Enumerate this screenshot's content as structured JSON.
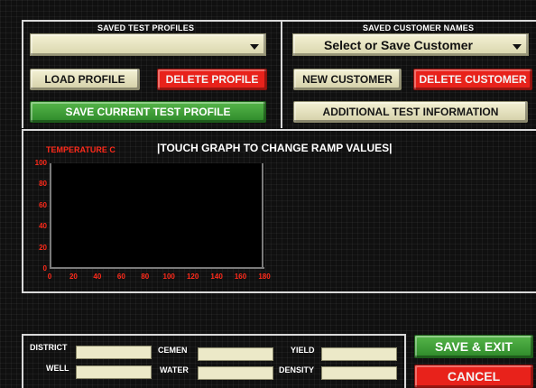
{
  "profiles": {
    "title": "SAVED TEST PROFILES",
    "dropdown_value": "",
    "load_label": "LOAD PROFILE",
    "delete_label": "DELETE PROFILE",
    "save_label": "SAVE CURRENT TEST PROFILE"
  },
  "customers": {
    "title": "SAVED CUSTOMER NAMES",
    "dropdown_value": "Select or Save Customer",
    "new_label": "NEW CUSTOMER",
    "delete_label": "DELETE CUSTOMER",
    "additional_label": "ADDITIONAL TEST INFORMATION"
  },
  "graph": {
    "instruction": "|TOUCH GRAPH TO CHANGE RAMP VALUES|"
  },
  "chart_data": {
    "type": "line",
    "ylabel": "TEMPERATURE C",
    "ylim": [
      0,
      100
    ],
    "xlim": [
      0,
      180
    ],
    "y_ticks": [
      "100",
      "80",
      "60",
      "40",
      "20",
      "0"
    ],
    "x_ticks": [
      "0",
      "20",
      "40",
      "60",
      "80",
      "100",
      "120",
      "140",
      "160",
      "180"
    ],
    "series": [],
    "axis_color": "#ff2a1a"
  },
  "fields": {
    "district": {
      "label": "DISTRICT",
      "value": ""
    },
    "well": {
      "label": "WELL",
      "value": ""
    },
    "cement": {
      "label": "CEMEN",
      "value": ""
    },
    "water": {
      "label": "WATER",
      "value": ""
    },
    "yield": {
      "label": "YIELD",
      "value": ""
    },
    "density": {
      "label": "DENSITY",
      "value": ""
    }
  },
  "actions": {
    "save_exit_label": "SAVE & EXIT",
    "cancel_label": "CANCEL"
  },
  "colors": {
    "background": "#101010",
    "button_cream": "#ece9c8",
    "button_red": "#e8221b",
    "button_green": "#3ea03a",
    "frame": "#d9d9d9"
  }
}
